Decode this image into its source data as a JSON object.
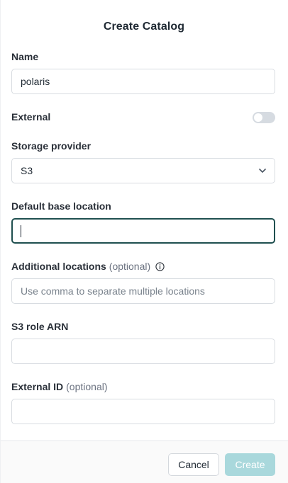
{
  "dialog": {
    "title": "Create Catalog"
  },
  "form": {
    "name": {
      "label": "Name",
      "value": "polaris"
    },
    "external": {
      "label": "External",
      "enabled": false
    },
    "storage_provider": {
      "label": "Storage provider",
      "selected": "S3",
      "icon": "chevron-down-icon"
    },
    "default_base_location": {
      "label": "Default base location",
      "value": ""
    },
    "additional_locations": {
      "label": "Additional locations",
      "optional": "(optional)",
      "placeholder": "Use comma to separate multiple locations",
      "icon": "info-icon"
    },
    "s3_role_arn": {
      "label": "S3 role ARN",
      "value": ""
    },
    "external_id": {
      "label": "External ID",
      "optional": "(optional)",
      "value": ""
    }
  },
  "footer": {
    "cancel_label": "Cancel",
    "create_label": "Create"
  },
  "colors": {
    "focus_border": "#1f4f4f",
    "create_button_disabled": "#a9d8dc",
    "toggle_off": "#d6dbe1"
  }
}
